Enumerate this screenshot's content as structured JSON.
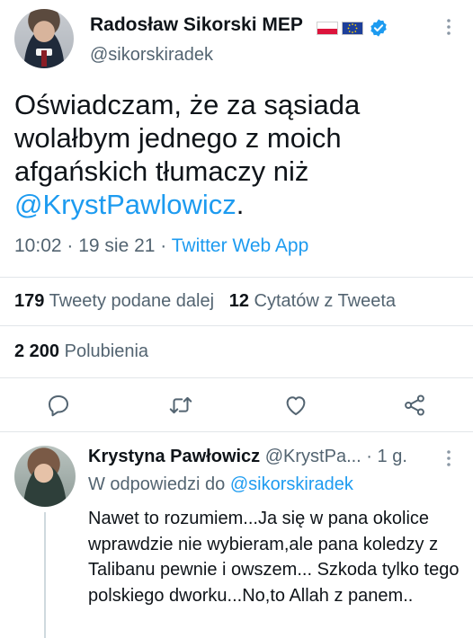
{
  "tweet": {
    "author_name": "Radosław Sikorski MEP",
    "author_handle": "@sikorskiradek",
    "text_main": "Oświadczam, że za sąsiada wolałbym jednego z moich afgańskich tłumaczy niż ",
    "text_mention": "@KrystPawlowicz",
    "text_end": ".",
    "time": "10:02 · 19 sie 21 · ",
    "source_app": "Twitter Web App",
    "retweets_count": "179",
    "retweets_label": "Tweety podane dalej",
    "quotes_count": "12",
    "quotes_label": "Cytatów z Tweeta",
    "likes_count": "2 200",
    "likes_label": "Polubienia"
  },
  "reply": {
    "author_name": "Krystyna Pawłowicz",
    "author_handle": "@KrystPa...",
    "age": " · 1 g.",
    "reply_prefix": "W odpowiedzi do ",
    "reply_to": "@sikorskiradek",
    "text": "Nawet to rozumiem...Ja się w pana okolice wprawdzie nie wybieram,ale pana koledzy z Talibanu pewnie i owszem... Szkoda tylko tego polskiego dworku...No,to Allah z panem.."
  },
  "icons": {
    "verified": "verified-badge-icon",
    "flag_pl": "poland-flag-icon",
    "flag_eu": "eu-flag-icon",
    "more": "more-vertical-icon",
    "reply": "reply-icon",
    "retweet": "retweet-icon",
    "like": "heart-icon",
    "share": "share-icon"
  },
  "colors": {
    "accent": "#1d9bf0",
    "secondary_text": "#536471",
    "primary_text": "#0f1419"
  }
}
